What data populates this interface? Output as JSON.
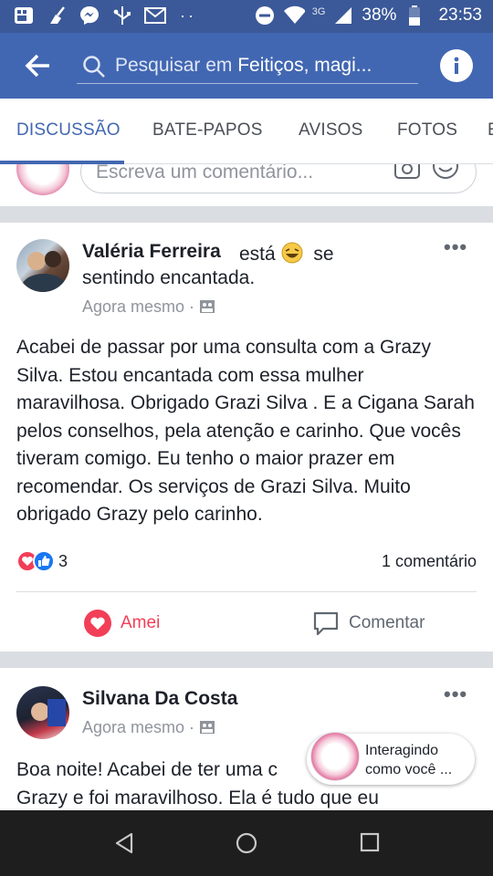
{
  "status_bar": {
    "network": "3G",
    "battery": "38%",
    "time": "23:53",
    "icons": [
      "gallery-icon",
      "cleaner-icon",
      "messenger-icon",
      "usb-icon",
      "gmail-icon",
      "more-dots-icon",
      "dnd-icon",
      "wifi-icon",
      "signal-icon",
      "battery-icon"
    ]
  },
  "header": {
    "search_prefix": "Pesquisar em ",
    "search_group": "Feitiços, magi..."
  },
  "tabs": [
    "DISCUSSÃO",
    "BATE-PAPOS",
    "AVISOS",
    "FOTOS",
    "E"
  ],
  "comment_box": {
    "placeholder": "Escreva um comentário..."
  },
  "posts": [
    {
      "author": "Valéria Ferreira",
      "feeling_prefix": "está",
      "feeling_suffix": "se",
      "feeling_line2": "sentindo encantada.",
      "time": "Agora mesmo",
      "text": "Acabei de passar por uma consulta com a Grazy Silva. Estou encantada com essa mulher maravilhosa. Obrigado Grazi Silva . E a Cigana Sarah pelos conselhos, pela atenção e carinho. Que vocês tiveram comigo. Eu tenho o maior prazer em recomendar. Os serviços de Grazi Silva. Muito obrigado Grazy pelo carinho.",
      "reactions_count": "3",
      "comments_count": "1 comentário",
      "action_like": "Amei",
      "action_comment": "Comentar"
    },
    {
      "author": "Silvana Da Costa",
      "time": "Agora mesmo",
      "text_line1": "Boa noite! Acabei de ter uma c",
      "text_line2": "Grazy e foi maravilhoso. Ela é  tudo que eu"
    }
  ],
  "chat_head": {
    "line1": "Interagindo",
    "line2": "como você ..."
  },
  "colors": {
    "brand": "#4267b2",
    "statusbar": "#3b5998",
    "love": "#f33e58"
  }
}
